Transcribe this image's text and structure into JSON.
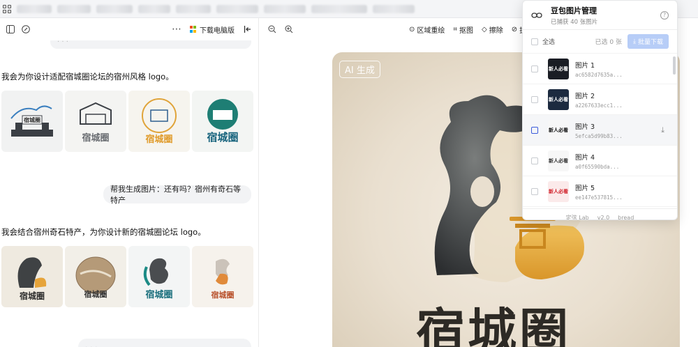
{
  "toolbar_left": {
    "download_label": "下载电脑版"
  },
  "toolbar_right": {
    "items": [
      {
        "label": "区域重绘",
        "icon": "region-redraw-icon"
      },
      {
        "label": "抠图",
        "icon": "crop-icon"
      },
      {
        "label": "擦除",
        "icon": "eraser-icon"
      },
      {
        "label": "扩",
        "icon": "expand-icon"
      }
    ]
  },
  "chat": {
    "assistant_msg_1": "我会为你设计适配宿城圈论坛的宿州风格 logo。",
    "user_msg_2": "帮我生成图片：还有吗？宿州有奇石等特产",
    "assistant_msg_2": "我会结合宿州奇石特产，为你设计新的宿城圈论坛 logo。",
    "logo_text_1": "宿城圈",
    "logo_text_2": "宿城圈",
    "logo_text_3": "宿城圈",
    "logo_text_4": "宿城圈",
    "logo_text_5": "宿城圈",
    "logo_text_6": "宿城圈",
    "logo_text_7": "宿城圈",
    "logo_text_8": "宿城圈"
  },
  "canvas": {
    "ai_badge": "AI 生成",
    "big_text": "宿城圈"
  },
  "panel": {
    "title": "豆包图片管理",
    "subtitle": "已捕获 40 张图片",
    "select_all": "全选",
    "selected_count": "已选 0 张",
    "batch_download": "批量下载",
    "items": [
      {
        "name": "图片 1",
        "hash": "ac6582d7635a...",
        "thumb_text": "新人必看",
        "thumb_bg": "#1a1d24",
        "thumb_color": "#ffffff"
      },
      {
        "name": "图片 2",
        "hash": "a2267633ecc1...",
        "thumb_text": "新人必看",
        "thumb_bg": "#1c2a3f",
        "thumb_color": "#ffffff"
      },
      {
        "name": "图片 3",
        "hash": "5efca5d99b83...",
        "thumb_text": "新人必看",
        "thumb_bg": "#f7f7f7",
        "thumb_color": "#111111"
      },
      {
        "name": "图片 4",
        "hash": "a0f65590bda...",
        "thumb_text": "新人必看",
        "thumb_bg": "#f7f7f7",
        "thumb_color": "#333333"
      },
      {
        "name": "图片 5",
        "hash": "ee147e537815...",
        "thumb_text": "新人必看",
        "thumb_bg": "#fbeaea",
        "thumb_color": "#d1222b"
      }
    ],
    "footer_brand": "定弦 Lab",
    "footer_version": "v2.0",
    "footer_tag": "bread"
  }
}
